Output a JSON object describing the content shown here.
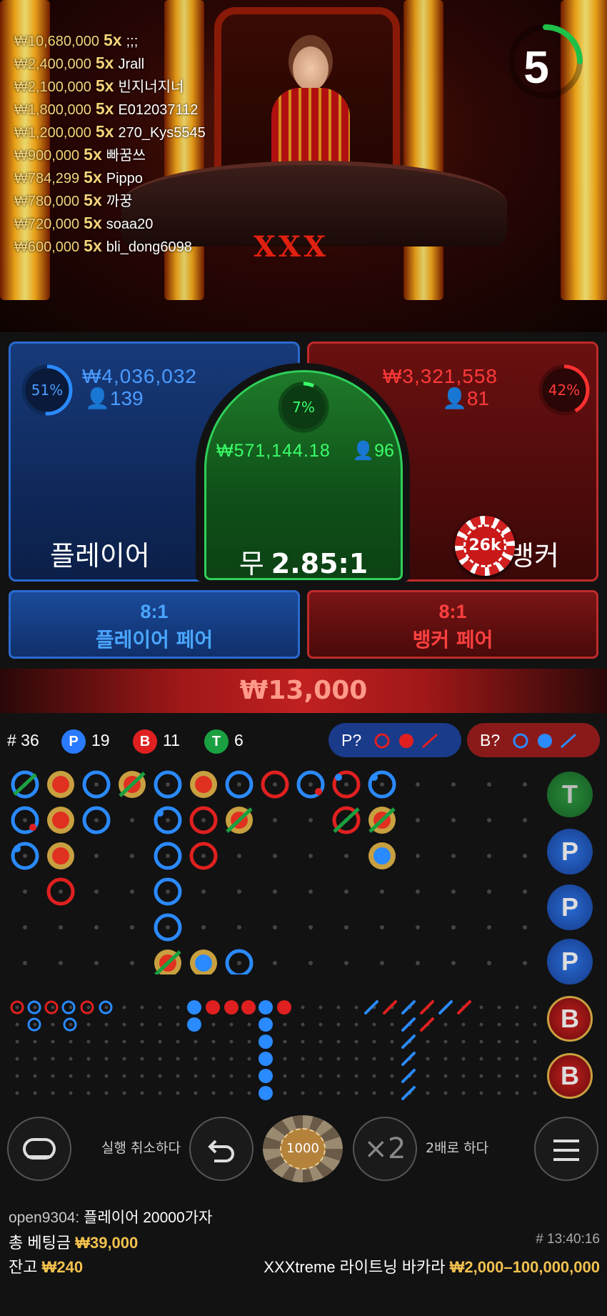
{
  "video": {
    "table_logo": "XXX",
    "timer": "5",
    "winners": [
      {
        "amount": "₩10,680,000",
        "mult": "5x",
        "user": ";;;"
      },
      {
        "amount": "₩2,400,000",
        "mult": "5x",
        "user": "Jrall"
      },
      {
        "amount": "₩2,100,000",
        "mult": "5x",
        "user": "빈지너지너"
      },
      {
        "amount": "₩1,800,000",
        "mult": "5x",
        "user": "E012037112"
      },
      {
        "amount": "₩1,200,000",
        "mult": "5x",
        "user": "270_Kys5545"
      },
      {
        "amount": "₩900,000",
        "mult": "5x",
        "user": "빠꿈쓰"
      },
      {
        "amount": "₩784,299",
        "mult": "5x",
        "user": "Pippo"
      },
      {
        "amount": "₩780,000",
        "mult": "5x",
        "user": "까꿍"
      },
      {
        "amount": "₩720,000",
        "mult": "5x",
        "user": "soaa20"
      },
      {
        "amount": "₩600,000",
        "mult": "5x",
        "user": "bli_dong6098"
      }
    ]
  },
  "bets": {
    "player": {
      "pct": "51%",
      "pct_value": 0.51,
      "amount": "₩4,036,032",
      "count": "139",
      "label": "플레이어"
    },
    "banker": {
      "pct": "42%",
      "pct_value": 0.42,
      "amount": "₩3,321,558",
      "count": "81",
      "label": "뱅커",
      "chip": "26k"
    },
    "tie": {
      "pct": "7%",
      "pct_value": 0.07,
      "amount": "₩571,144.18",
      "count": "96",
      "label": "무",
      "odds": "2.85:1"
    },
    "player_pair": {
      "odds": "8:1",
      "label": "플레이어 페어"
    },
    "banker_pair": {
      "odds": "8:1",
      "label": "뱅커 페어"
    },
    "total": "₩13,000"
  },
  "stats": {
    "rounds": "# 36",
    "player": {
      "letter": "P",
      "count": "19"
    },
    "banker": {
      "letter": "B",
      "count": "11"
    },
    "tie": {
      "letter": "T",
      "count": "6"
    },
    "player_predict": "P?",
    "banker_predict": "B?"
  },
  "side_buttons": [
    "T",
    "P",
    "P",
    "P",
    "B",
    "B"
  ],
  "controls": {
    "undo_label": "실행 취소하다",
    "chip_value": "1000",
    "double_symbol": "×2",
    "double_label": "2배로 하다"
  },
  "footer": {
    "chat_user": "open9304:",
    "chat_message": "플레이어 20000가자",
    "total_bet_label": "총 베팅금",
    "total_bet_value": "₩39,000",
    "balance_label": "잔고",
    "balance_value": "₩240",
    "time": "# 13:40:16",
    "game_name": "XXXtreme 라이트닝 바카라",
    "limits": "₩2,000–100,000,000"
  },
  "colors": {
    "player": "#2a7aff",
    "banker": "#e02020",
    "tie": "#1aa040",
    "gold": "#f2c14e"
  }
}
